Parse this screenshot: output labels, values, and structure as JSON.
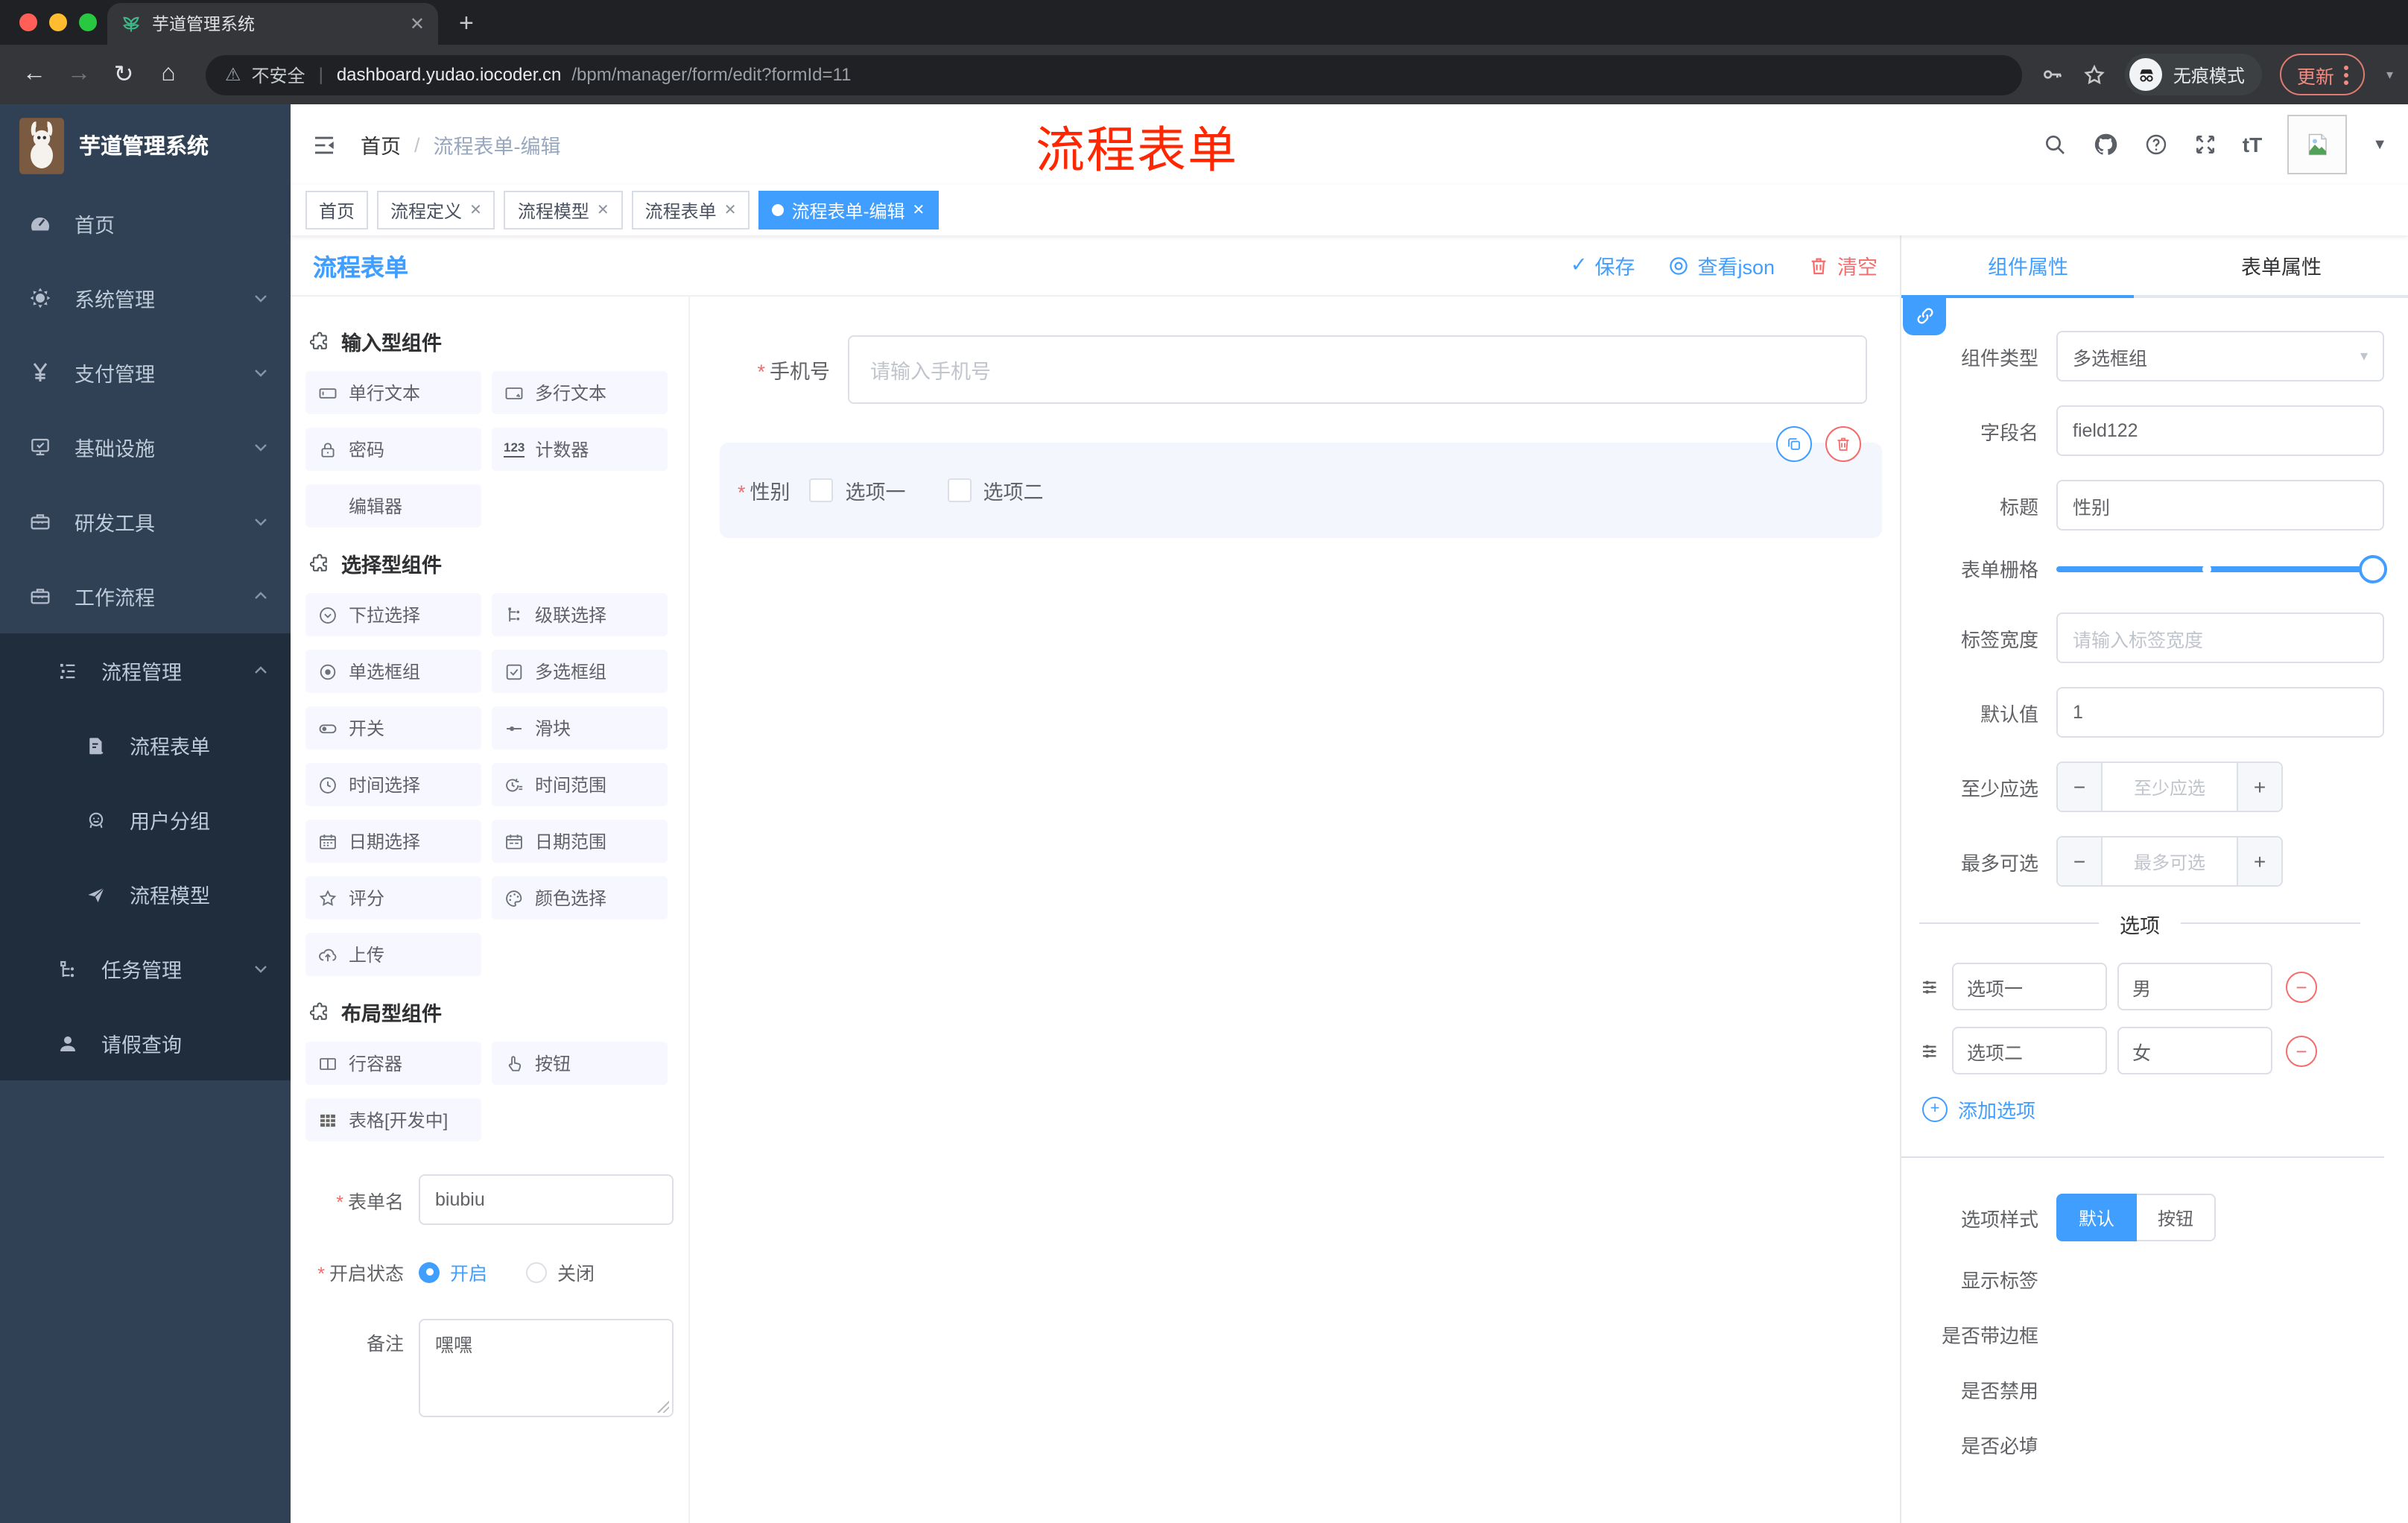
{
  "browser": {
    "tab_title": "芋道管理系统",
    "security": "不安全",
    "url_host": "dashboard.yudao.iocoder.cn",
    "url_path": "/bpm/manager/form/edit?formId=11",
    "incognito": "无痕模式",
    "update": "更新"
  },
  "sidebar": {
    "logo_title": "芋道管理系统",
    "items": [
      {
        "icon": "dashboard-icon",
        "label": "首页"
      },
      {
        "icon": "gear-icon",
        "label": "系统管理"
      },
      {
        "icon": "yen-icon",
        "label": "支付管理"
      },
      {
        "icon": "infra-icon",
        "label": "基础设施"
      },
      {
        "icon": "tools-icon",
        "label": "研发工具"
      },
      {
        "icon": "workflow-icon",
        "label": "工作流程"
      }
    ],
    "submenu": {
      "group1": {
        "icon": "tree-icon",
        "label": "流程管理",
        "children": [
          {
            "icon": "form-icon",
            "label": "流程表单"
          },
          {
            "icon": "group-icon",
            "label": "用户分组"
          },
          {
            "icon": "model-icon",
            "label": "流程模型"
          }
        ]
      },
      "group2": {
        "icon": "task-icon",
        "label": "任务管理"
      },
      "leave": {
        "icon": "user-icon",
        "label": "请假查询"
      }
    }
  },
  "header": {
    "breadcrumb_home": "首页",
    "breadcrumb_sep": "/",
    "breadcrumb_current": "流程表单-编辑",
    "annotation": "流程表单"
  },
  "tags": [
    {
      "label": "首页"
    },
    {
      "label": "流程定义"
    },
    {
      "label": "流程模型"
    },
    {
      "label": "流程表单"
    },
    {
      "label": "流程表单-编辑"
    }
  ],
  "toolbar": {
    "title": "流程表单",
    "save": "保存",
    "view_json": "查看json",
    "clear": "清空"
  },
  "palette": {
    "sections": [
      {
        "title": "输入型组件",
        "items": [
          {
            "icon": "input-icon",
            "label": "单行文本"
          },
          {
            "icon": "textarea-icon",
            "label": "多行文本"
          },
          {
            "icon": "password-icon",
            "label": "密码"
          },
          {
            "icon": "counter-icon",
            "label": "计数器"
          },
          {
            "icon": "",
            "label": "编辑器"
          }
        ]
      },
      {
        "title": "选择型组件",
        "items": [
          {
            "icon": "select-icon",
            "label": "下拉选择"
          },
          {
            "icon": "cascader-icon",
            "label": "级联选择"
          },
          {
            "icon": "radio-icon",
            "label": "单选框组"
          },
          {
            "icon": "checkbox-icon",
            "label": "多选框组"
          },
          {
            "icon": "switch-icon",
            "label": "开关"
          },
          {
            "icon": "slider-icon",
            "label": "滑块"
          },
          {
            "icon": "time-icon",
            "label": "时间选择"
          },
          {
            "icon": "time-range-icon",
            "label": "时间范围"
          },
          {
            "icon": "date-icon",
            "label": "日期选择"
          },
          {
            "icon": "date-range-icon",
            "label": "日期范围"
          },
          {
            "icon": "rate-icon",
            "label": "评分"
          },
          {
            "icon": "color-icon",
            "label": "颜色选择"
          },
          {
            "icon": "upload-icon",
            "label": "上传"
          }
        ]
      },
      {
        "title": "布局型组件",
        "items": [
          {
            "icon": "row-icon",
            "label": "行容器"
          },
          {
            "icon": "button-icon",
            "label": "按钮"
          },
          {
            "icon": "table-icon",
            "label": "表格[开发中]"
          }
        ]
      }
    ]
  },
  "icons": {
    "counter_text": "123",
    "fontsize_text": "tT"
  },
  "meta_form": {
    "name_label": "表单名",
    "name_value": "biubiu",
    "status_label": "开启状态",
    "status_on": "开启",
    "status_off": "关闭",
    "remark_label": "备注",
    "remark_value": "嘿嘿"
  },
  "canvas": {
    "phone": {
      "label": "手机号",
      "placeholder": "请输入手机号"
    },
    "gender": {
      "label": "性别",
      "options": [
        "选项一",
        "选项二"
      ]
    }
  },
  "panel": {
    "tab_component": "组件属性",
    "tab_form": "表单属性",
    "rows": {
      "type_label": "组件类型",
      "type_value": "多选框组",
      "field_label": "字段名",
      "field_value": "field122",
      "title_label": "标题",
      "title_value": "性别",
      "grid_label": "表单栅格",
      "width_label": "标签宽度",
      "width_placeholder": "请输入标签宽度",
      "default_label": "默认值",
      "default_value": "1",
      "min_label": "至少应选",
      "min_placeholder": "至少应选",
      "max_label": "最多可选",
      "max_placeholder": "最多可选"
    },
    "options_divider": "选项",
    "options": [
      {
        "label": "选项一",
        "value": "男"
      },
      {
        "label": "选项二",
        "value": "女"
      }
    ],
    "add_option": "添加选项",
    "style_label": "选项样式",
    "style_default": "默认",
    "style_button": "按钮",
    "switches": [
      {
        "label": "显示标签",
        "on": true
      },
      {
        "label": "是否带边框",
        "on": false
      },
      {
        "label": "是否禁用",
        "on": false
      },
      {
        "label": "是否必填",
        "on": true
      }
    ]
  },
  "colors": {
    "accent": "#409eff",
    "danger": "#f56c6c",
    "annotation": "#fe2702",
    "sidebar_bg": "#304156",
    "submenu_bg": "#1f2d3d"
  }
}
